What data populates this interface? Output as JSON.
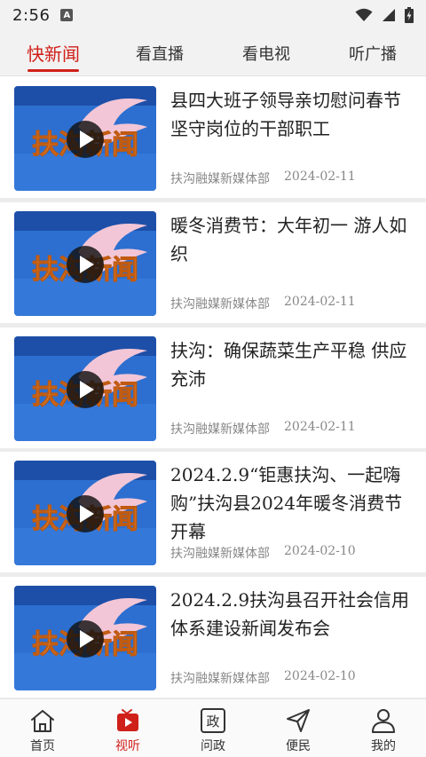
{
  "status_bar": {
    "time": "2:56",
    "notification": "A"
  },
  "tabs": [
    {
      "label": "快新闻",
      "active": true
    },
    {
      "label": "看直播",
      "active": false
    },
    {
      "label": "看电视",
      "active": false
    },
    {
      "label": "听广播",
      "active": false
    }
  ],
  "thumbnail_text": "扶沟新闻",
  "news": [
    {
      "title": "县四大班子领导亲切慰问春节坚守岗位的干部职工",
      "source": "扶沟融媒新媒体部",
      "date": "2024-02-11"
    },
    {
      "title": "暖冬消费节：大年初一 游人如织",
      "source": "扶沟融媒新媒体部",
      "date": "2024-02-11"
    },
    {
      "title": "扶沟：确保蔬菜生产平稳 供应充沛",
      "source": "扶沟融媒新媒体部",
      "date": "2024-02-11"
    },
    {
      "title": "2024.2.9“钜惠扶沟、一起嗨购”扶沟县2024年暖冬消费节开幕",
      "source": "扶沟融媒新媒体部",
      "date": "2024-02-10"
    },
    {
      "title": "2024.2.9扶沟县召开社会信用体系建设新闻发布会",
      "source": "扶沟融媒新媒体部",
      "date": "2024-02-10"
    }
  ],
  "bottom_nav": [
    {
      "label": "首页",
      "icon": "home-icon",
      "active": false
    },
    {
      "label": "视听",
      "icon": "tv-play-icon",
      "active": true
    },
    {
      "label": "问政",
      "icon": "zheng-icon",
      "active": false
    },
    {
      "label": "便民",
      "icon": "send-icon",
      "active": false
    },
    {
      "label": "我的",
      "icon": "user-icon",
      "active": false
    }
  ],
  "colors": {
    "accent": "#d0201a",
    "tab_bg": "#f2f2f2",
    "meta_text": "#888888"
  }
}
